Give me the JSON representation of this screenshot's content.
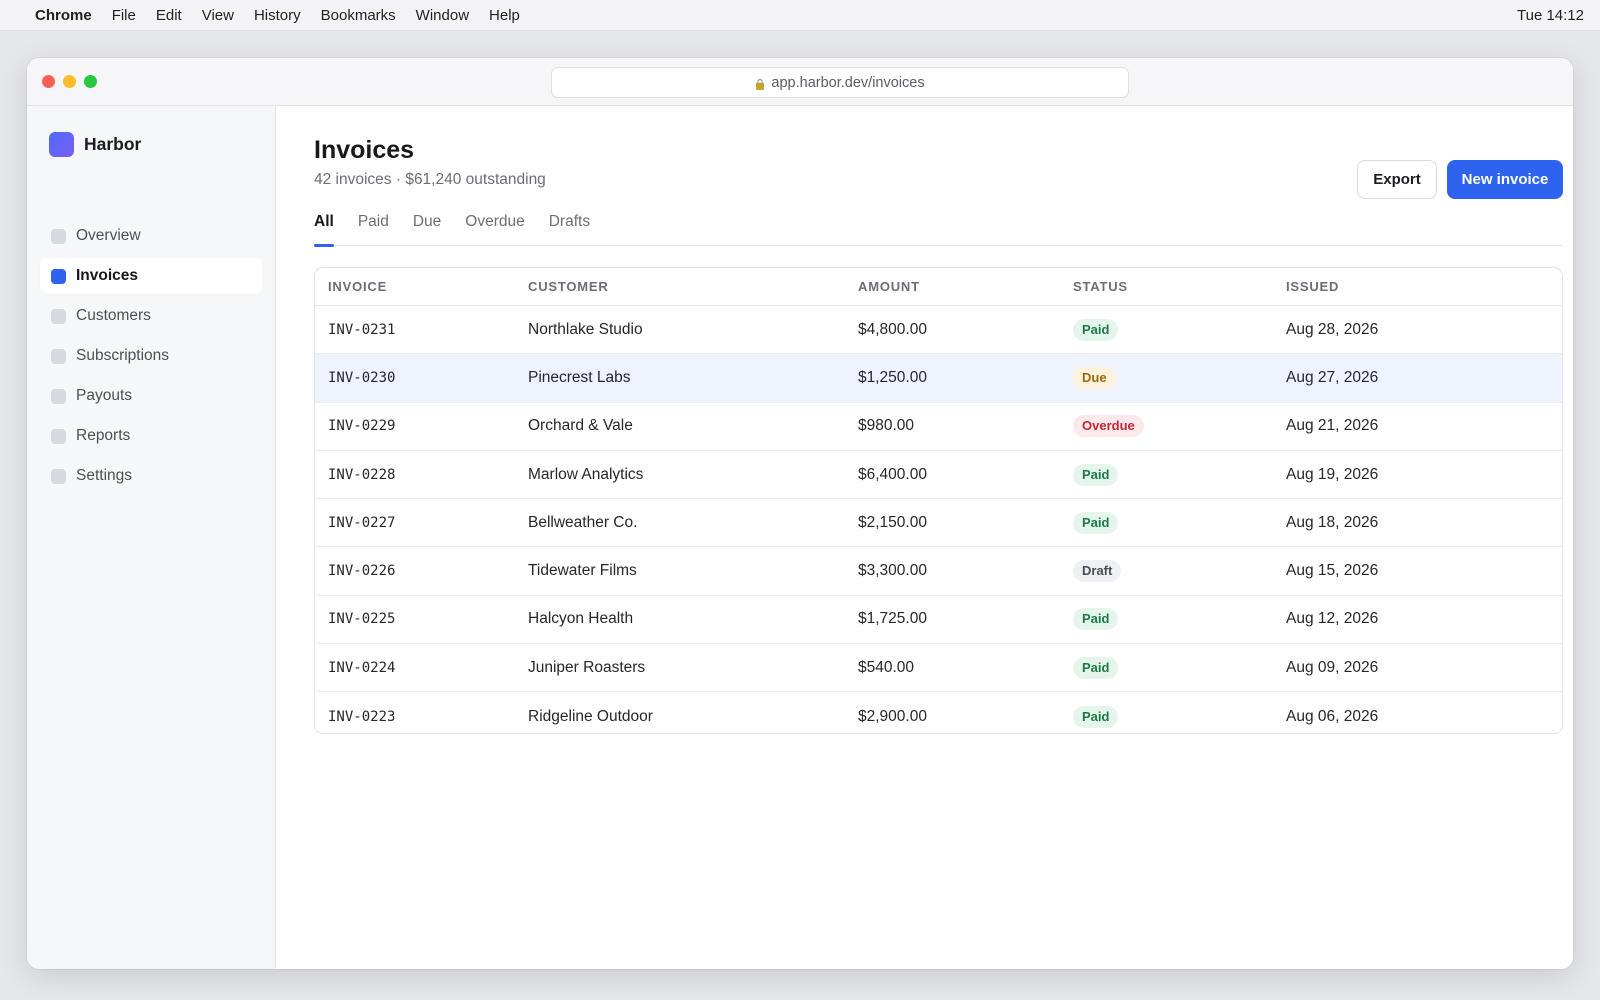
{
  "menubar": {
    "app": "Chrome",
    "menus": [
      "File",
      "Edit",
      "View",
      "History",
      "Bookmarks",
      "Window",
      "Help"
    ],
    "clock": "Tue 14:12"
  },
  "browser": {
    "url": "app.harbor.dev/invoices"
  },
  "sidebar": {
    "brand": "Harbor",
    "items": [
      {
        "label": "Overview",
        "active": false
      },
      {
        "label": "Invoices",
        "active": true
      },
      {
        "label": "Customers",
        "active": false
      },
      {
        "label": "Subscriptions",
        "active": false
      },
      {
        "label": "Payouts",
        "active": false
      },
      {
        "label": "Reports",
        "active": false
      },
      {
        "label": "Settings",
        "active": false
      }
    ]
  },
  "header": {
    "title": "Invoices",
    "subtitle": "42 invoices · $61,240 outstanding",
    "export_label": "Export",
    "new_label": "New invoice"
  },
  "tabs": [
    {
      "label": "All",
      "active": true
    },
    {
      "label": "Paid",
      "active": false
    },
    {
      "label": "Due",
      "active": false
    },
    {
      "label": "Overdue",
      "active": false
    },
    {
      "label": "Drafts",
      "active": false
    }
  ],
  "table": {
    "columns": [
      "INVOICE",
      "CUSTOMER",
      "AMOUNT",
      "STATUS",
      "ISSUED"
    ],
    "rows": [
      {
        "invoice": "INV-0231",
        "customer": "Northlake Studio",
        "amount": "$4,800.00",
        "status": "Paid",
        "status_kind": "paid",
        "issued": "Aug 28, 2026"
      },
      {
        "invoice": "INV-0230",
        "customer": "Pinecrest Labs",
        "amount": "$1,250.00",
        "status": "Due",
        "status_kind": "due",
        "issued": "Aug 27, 2026",
        "highlighted": true
      },
      {
        "invoice": "INV-0229",
        "customer": "Orchard & Vale",
        "amount": "$980.00",
        "status": "Overdue",
        "status_kind": "overdue",
        "issued": "Aug 21, 2026"
      },
      {
        "invoice": "INV-0228",
        "customer": "Marlow Analytics",
        "amount": "$6,400.00",
        "status": "Paid",
        "status_kind": "paid",
        "issued": "Aug 19, 2026"
      },
      {
        "invoice": "INV-0227",
        "customer": "Bellweather Co.",
        "amount": "$2,150.00",
        "status": "Paid",
        "status_kind": "paid",
        "issued": "Aug 18, 2026"
      },
      {
        "invoice": "INV-0226",
        "customer": "Tidewater Films",
        "amount": "$3,300.00",
        "status": "Draft",
        "status_kind": "draft",
        "issued": "Aug 15, 2026"
      },
      {
        "invoice": "INV-0225",
        "customer": "Halcyon Health",
        "amount": "$1,725.00",
        "status": "Paid",
        "status_kind": "paid",
        "issued": "Aug 12, 2026"
      },
      {
        "invoice": "INV-0224",
        "customer": "Juniper Roasters",
        "amount": "$540.00",
        "status": "Paid",
        "status_kind": "paid",
        "issued": "Aug 09, 2026"
      },
      {
        "invoice": "INV-0223",
        "customer": "Ridgeline Outdoor",
        "amount": "$2,900.00",
        "status": "Paid",
        "status_kind": "paid",
        "issued": "Aug 06, 2026"
      }
    ]
  },
  "colors": {
    "accent": "#2d63ee",
    "paid": "#1d7a47",
    "due": "#9a6a0b",
    "overdue": "#c2283a",
    "draft": "#4a4d55"
  },
  "icons": {
    "lock": "lock-icon",
    "brand": "harbor-logo-icon",
    "nav": "nav-item-icon"
  }
}
